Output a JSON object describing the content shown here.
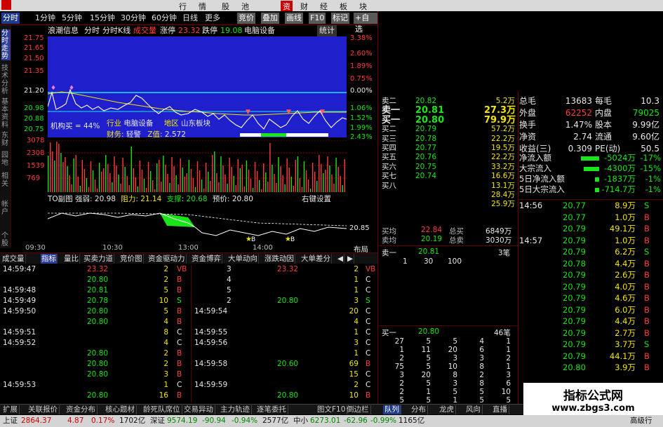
{
  "menu": [
    "行",
    "情",
    "股",
    "池",
    "资",
    "财",
    "经",
    "板",
    "块"
  ],
  "toolbar": {
    "periods": [
      "分时",
      "1分钟",
      "5分钟",
      "15分钟",
      "30分钟",
      "60分钟",
      "日线",
      "更多"
    ],
    "buttons": [
      "竞价",
      "叠加",
      "画线",
      "F10",
      "标记",
      "+自选"
    ]
  },
  "vtabs": [
    "分时走势",
    "技术分析",
    "基本资料",
    "东财",
    "园地",
    "相关",
    "帐户",
    "个股"
  ],
  "info": {
    "name": "浪潮信息",
    "tab1": "分时",
    "tab2": "分时K线",
    "chengjiao_label": "成交量",
    "zt_label": "涨停",
    "zt": "23.32",
    "dt_label": "跌停",
    "dt": "19.08",
    "industry": "电脑设备",
    "tongji": "统计"
  },
  "yleft": [
    "21.75",
    "21.65",
    "21.50",
    "21.35",
    "21.20",
    "20.98",
    "20.88",
    "20.75"
  ],
  "yright": [
    "3.38%",
    "2.60%",
    "1.89%",
    "0.75%",
    "0.00%",
    "1.06%",
    "1.52%",
    "1.99%",
    "2.43%"
  ],
  "vol_y": [
    "3078",
    "2308",
    "1539",
    "769"
  ],
  "overlay": {
    "jigou": "机构买",
    "jigou_pct": "= 44%",
    "hangye": "行业",
    "hangye_val": "电脑设备",
    "diqu": "地区",
    "diqu_val": "山东板块",
    "caiwu": "财务",
    "caiwu_val": "轻警",
    "zzhi": "Z值",
    "zzhi_val": "2.572"
  },
  "ind": {
    "name": "TO副图",
    "label": "强弱",
    "val": "20.98",
    "zl": "阻力",
    "zl_v": "21.14",
    "zc": "支撑",
    "zc_v": "20.68",
    "yd": "预价",
    "yd_v": "20.80",
    "btn": "右键设置",
    "right": "20.85"
  },
  "times": [
    "09:30",
    "10:30",
    "13:00",
    "14:00"
  ],
  "buju": "布局",
  "subtabs": [
    "成交量",
    "指标",
    "量比",
    "买卖力道",
    "竞价图",
    "资金驱动力",
    "资金博弈",
    "大单动向",
    "涨跌动因",
    "大单差分"
  ],
  "ticks_left": [
    [
      "14:59:47",
      "23.32",
      "2",
      "VB"
    ],
    [
      "",
      "20.80",
      "2",
      "B"
    ],
    [
      "14:59:48",
      "20.81",
      "5",
      "B"
    ],
    [
      "14:59:49",
      "20.78",
      "10",
      "S"
    ],
    [
      "14:59:50",
      "20.80",
      "5",
      "B"
    ],
    [
      "",
      "20.80",
      "4",
      "B"
    ],
    [
      "14:59:51",
      "",
      "8",
      "C"
    ],
    [
      "14:59:52",
      "",
      "4",
      "C"
    ],
    [
      "",
      "20.80",
      "2",
      "B"
    ],
    [
      "",
      "20.80",
      "2",
      "B"
    ],
    [
      "",
      "20.80",
      "3",
      "B"
    ],
    [
      "14:59:53",
      "",
      "1",
      "C"
    ],
    [
      "",
      "20.80",
      "16",
      "B"
    ]
  ],
  "ticks_mid": [
    [
      "",
      "3",
      "23.32",
      "2",
      "VB"
    ],
    [
      "",
      "4",
      "",
      "1",
      "C"
    ],
    [
      "",
      "5",
      "",
      "1",
      "C"
    ],
    [
      "",
      "2",
      "20.80",
      "3",
      "S"
    ],
    [
      "14:59:54",
      "",
      "",
      "20",
      "C"
    ],
    [
      "",
      "",
      "",
      "4",
      "C"
    ],
    [
      "14:59:55",
      "",
      "",
      "1",
      "C"
    ],
    [
      "14:59:56",
      "",
      "",
      "3",
      "C"
    ],
    [
      "",
      "",
      "",
      "1",
      "C"
    ],
    [
      "14:59:58",
      "",
      "20.60",
      "69",
      "B"
    ],
    [
      "",
      "",
      "",
      "15",
      "C"
    ],
    [
      "14:59:59",
      "",
      "",
      "2",
      "C"
    ],
    [
      "",
      "",
      "20.80",
      "10",
      "B"
    ]
  ],
  "orderbook": [
    [
      "卖二",
      "20.82",
      "5.2万"
    ],
    [
      "卖一",
      "20.81",
      "27.3万"
    ],
    [
      "买一",
      "20.80",
      "79.9万"
    ],
    [
      "买二",
      "20.79",
      "57.2万"
    ],
    [
      "买三",
      "20.78",
      "22.2万"
    ],
    [
      "买四",
      "20.77",
      "19.5万"
    ],
    [
      "买五",
      "20.76",
      "22.2万"
    ],
    [
      "买六",
      "20.75",
      "33.2万"
    ],
    [
      "买七",
      "20.74",
      "16.6万"
    ],
    [
      "买八",
      "",
      "13.1万"
    ],
    [
      "",
      "",
      "28.4万"
    ],
    [
      "",
      "",
      "25.9万"
    ]
  ],
  "junjia": {
    "l1": "买均",
    "v1": "22.84",
    "t1": "总买",
    "n1": "6849万",
    "l2": "卖均",
    "v2": "20.19",
    "t2": "总卖",
    "n2": "3030万"
  },
  "queue_sell": {
    "label": "卖一",
    "price": "20.81",
    "cnt": "3笔",
    "vals": [
      "1",
      "30",
      "100"
    ]
  },
  "queue_buy": {
    "label": "买一",
    "price": "20.80",
    "cnt": "46笔"
  },
  "queue_grid": [
    [
      "27",
      "5",
      "5",
      "4",
      "1"
    ],
    [
      "1",
      "11",
      "20",
      "6",
      "1"
    ],
    [
      "2",
      "5",
      "3",
      "3",
      "2"
    ],
    [
      "75",
      "5",
      "10",
      "8",
      "1"
    ],
    [
      "3",
      "20",
      "8",
      "2",
      "3"
    ],
    [
      "2",
      "5",
      "3",
      "8",
      "6"
    ],
    [
      "2",
      "1",
      "5",
      "5",
      "10"
    ],
    [
      "5",
      "5",
      "1",
      "5",
      "5"
    ]
  ],
  "stats": [
    [
      "总毛",
      "13683",
      "每毛",
      "10.3"
    ],
    [
      "外盘",
      "62252",
      "内盘",
      "79025"
    ],
    [
      "换手",
      "1.47%",
      "股本",
      "9.99亿"
    ],
    [
      "净资",
      "2.74",
      "流通",
      "9.60亿"
    ],
    [
      "收益(三)",
      "0.309",
      "PE(动)",
      "50.5"
    ]
  ],
  "flows": [
    [
      "净流入额",
      "-5024万",
      "-17%"
    ],
    [
      "大宗流入",
      "-4300万",
      "-15%"
    ],
    [
      "5日净流入额",
      "-1837万",
      "-1%"
    ],
    [
      "5日大宗流入",
      "-714.7万",
      "-1%"
    ]
  ],
  "rticks": [
    [
      "14:56",
      "20.77",
      "8.9万",
      "S"
    ],
    [
      "",
      "20.77",
      "1.0万",
      "B"
    ],
    [
      "",
      "20.79",
      "49.1万",
      "B"
    ],
    [
      "14:57",
      "20.79",
      "1.0万",
      "B"
    ],
    [
      "",
      "20.79",
      "6.2万",
      "S"
    ],
    [
      "",
      "20.78",
      "4.4万",
      "B"
    ],
    [
      "",
      "20.79",
      "2.6万",
      "B"
    ],
    [
      "",
      "20.79",
      "4.0万",
      "B"
    ],
    [
      "",
      "20.79",
      "4.6万",
      "B"
    ],
    [
      "",
      "20.79",
      "6.0万",
      "B"
    ],
    [
      "",
      "20.79",
      "4.4万",
      "B"
    ],
    [
      "",
      "20.79",
      "2.7万",
      "B"
    ],
    [
      "",
      "20.79",
      "3.7万",
      "S"
    ],
    [
      "",
      "20.79",
      "44.1万",
      "B"
    ],
    [
      "",
      "20.80",
      "3.9万",
      "B"
    ]
  ],
  "footer": [
    "扩展",
    "关联报价",
    "资金分布",
    "核心题材",
    "龄死队席位",
    "交易异动",
    "主力轨迹",
    "逐笔委托",
    "图文F10",
    "倒边栏",
    "队列",
    "分布",
    "龙虎",
    "风向",
    "直播"
  ],
  "status": {
    "sh": "上证",
    "sh_v": "2864.37",
    "sh_c": "4.87",
    "sh_p": "0.17%",
    "sh_a": "1702亿",
    "sz": "深证",
    "sz_v": "9574.19",
    "sz_c": "-90.94",
    "sz_p": "-0.94%",
    "sz_a": "2577亿",
    "zx": "中小",
    "zx_v": "6273.01",
    "zx_c": "-62.96",
    "zx_p": "-0.99%",
    "zx_a": "1165亿",
    "end": "高级行"
  },
  "watermark": {
    "title": "指标公式网",
    "url": "www.zbgs3.com"
  },
  "colors": {
    "up": "#ff3c3c",
    "down": "#19e619",
    "pane": "#1f1fcc"
  }
}
